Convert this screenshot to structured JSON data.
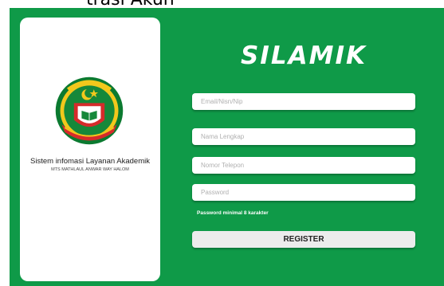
{
  "page": {
    "heading": "trasi Akun"
  },
  "left_card": {
    "logo_icon": "school-emblem-icon",
    "system_name": "Sistem infomasi Layanan Akademik",
    "school_name": "MTS MATHLAUL ANWAR WAY HALOM"
  },
  "form": {
    "brand": "SILAMIK",
    "fields": {
      "email": {
        "placeholder": "Email/Nisn/Nip",
        "value": ""
      },
      "full_name": {
        "placeholder": "Nama Lengkap",
        "value": ""
      },
      "phone": {
        "placeholder": "Nomor Telepon",
        "value": ""
      },
      "password": {
        "placeholder": "Password",
        "value": ""
      }
    },
    "password_hint": "Password minimal 8 karakter",
    "register_label": "REGISTER"
  },
  "colors": {
    "panel_green": "#0f9a48",
    "card_white": "#ffffff",
    "button_gray": "#ececec"
  }
}
